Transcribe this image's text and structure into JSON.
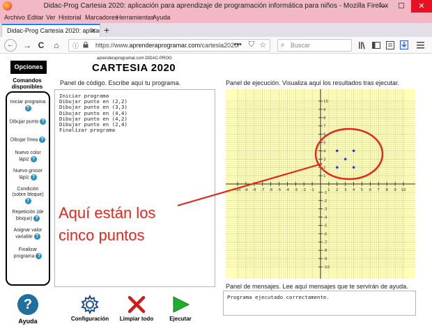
{
  "window": {
    "title": "Didac-Prog Cartesia 2020: aplicación para aprendizaje de programación informática para niños - Mozilla Firefox",
    "minimize": "—",
    "maximize": "☐",
    "close": "✕"
  },
  "menu": [
    "Archivo",
    "Editar",
    "Ver",
    "Historial",
    "Marcadores",
    "Herramientas",
    "Ayuda"
  ],
  "tab": {
    "label": "Didac-Prog Cartesia 2020: aplicació",
    "close": "✕",
    "new": "+"
  },
  "nav": {
    "back": "←",
    "forward": "→",
    "reload": "C",
    "home": "⌂",
    "url_prefix": "https://www.",
    "url_host": "aprenderaprogramar.com",
    "url_path": "/cartesia2020/",
    "url_menu": "•••",
    "search_placeholder": "Buscar",
    "toolbar_icons": [
      "library-icon",
      "sidebar-icon",
      "reader-icon",
      "download-icon",
      "menu-icon"
    ]
  },
  "page": {
    "opciones": "Opciones",
    "comandos_title": "Comandos disponibles",
    "commands": [
      "Iniciar programa",
      "Dibujar punto",
      "Dibujar línea",
      "Nuevo color lápiz",
      "Nuevo grosor lápiz",
      "Condición (sobre bloque)",
      "Repetición (de bloque)",
      "Asignar valor variable",
      "Finalizar programa"
    ],
    "help_glyph": "?",
    "ayuda": "Ayuda",
    "subtitle": "aprenderaprogramar.com DIDAC-PROG",
    "app_title": "CARTESIA 2020",
    "code_label": "Panel de código. Escribe aquí tu programa.",
    "code_lines": [
      "Iniciar programa",
      "Dibujar punto en (2,2)",
      "Dibujar punto en (3,3)",
      "Dibujar punto en (4,4)",
      "Dibujar punto en (4,2)",
      "Dibujar punto en (2,4)",
      "Finalizar programa"
    ],
    "buttons": {
      "config": "Configuración",
      "clear": "Limpiar todo",
      "run": "Ejecutar"
    },
    "exec_label": "Panel de ejecución. Visualiza aquí los resultados tras ejecutar.",
    "msg_label": "Panel de mensajes. Lee aquí mensajes que te servirán de ayuda.",
    "msg_text": "Programa ejecutado correctamente.",
    "annotation_line1": "Aquí están los",
    "annotation_line2": "cinco puntos"
  },
  "colors": {
    "grid_bg": "#ffffb8",
    "grid_line": "#c9c9a0",
    "axis": "#222222",
    "point": "#1a3fd6",
    "annotation": "#e8251b",
    "titlebar": "#f2b8c6"
  },
  "chart_data": {
    "type": "scatter",
    "title": "",
    "xlabel": "",
    "ylabel": "",
    "xlim": [
      -10,
      10
    ],
    "ylim": [
      -10,
      10
    ],
    "grid": true,
    "x_ticks": [
      -10,
      -9,
      -8,
      -7,
      -6,
      -5,
      -4,
      -3,
      -2,
      -1,
      1,
      2,
      3,
      4,
      5,
      6,
      7,
      8,
      9,
      10
    ],
    "y_ticks": [
      -10,
      -9,
      -8,
      -7,
      -6,
      -5,
      -4,
      -3,
      -2,
      -1,
      1,
      2,
      3,
      4,
      5,
      6,
      7,
      8,
      9,
      10
    ],
    "points": [
      {
        "x": 2,
        "y": 2
      },
      {
        "x": 3,
        "y": 3
      },
      {
        "x": 4,
        "y": 4
      },
      {
        "x": 4,
        "y": 2
      },
      {
        "x": 2,
        "y": 4
      }
    ]
  }
}
